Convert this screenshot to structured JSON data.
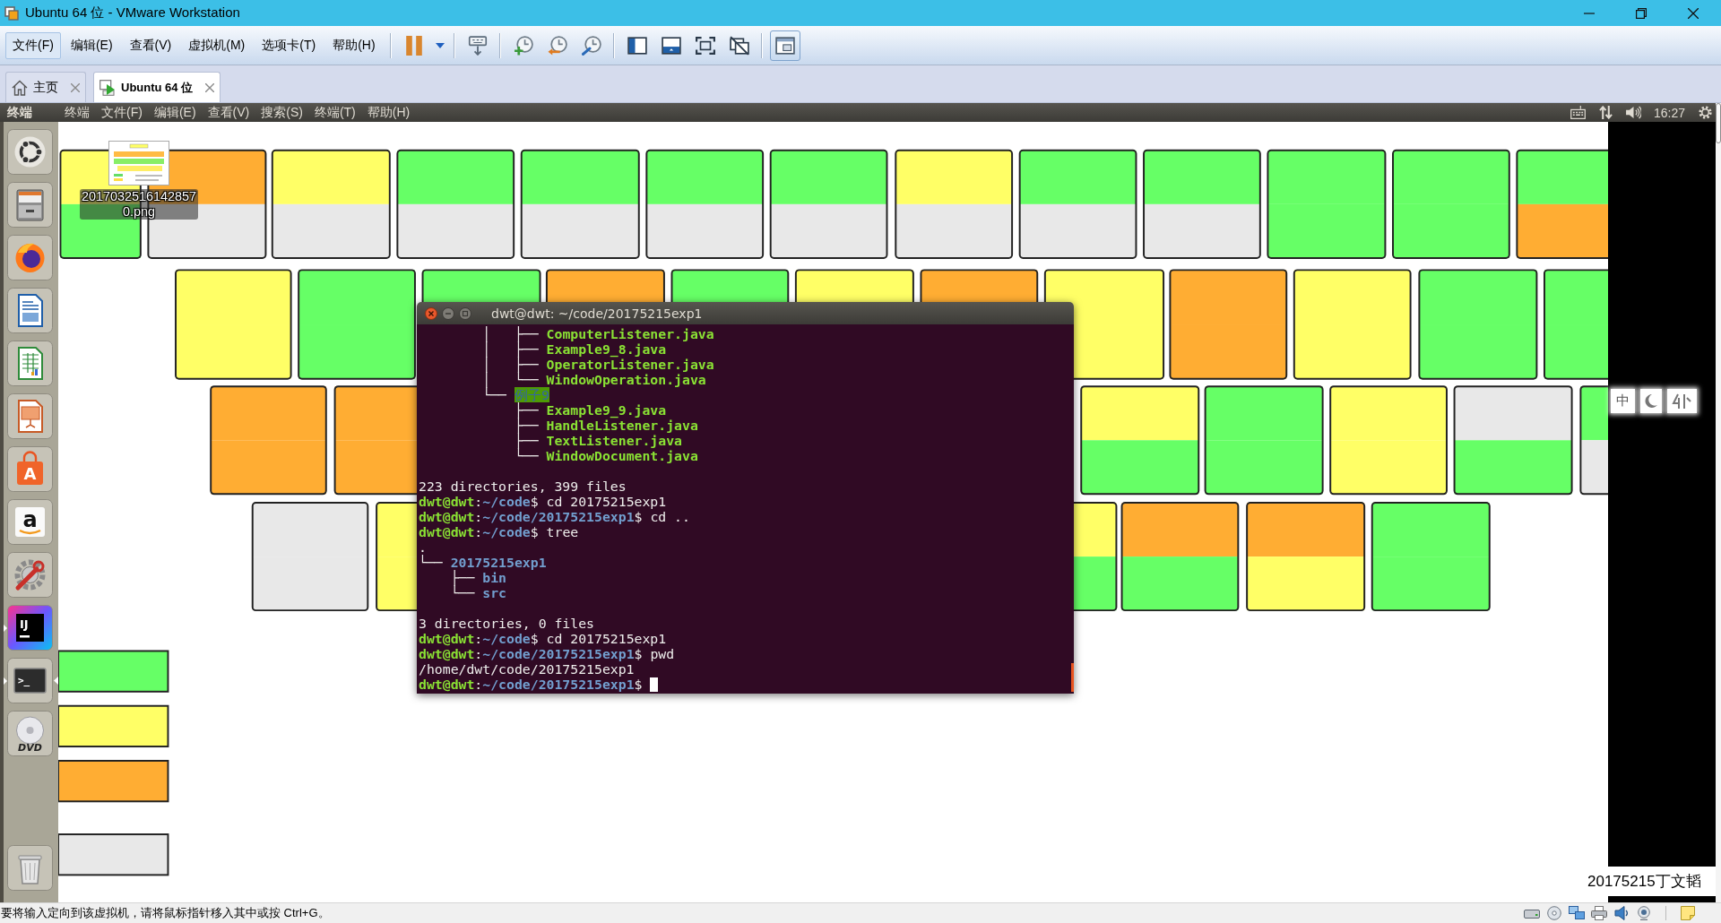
{
  "window": {
    "title": "Ubuntu 64 位 - VMware Workstation"
  },
  "menu": [
    {
      "label": "文件(F)",
      "highlighted": true
    },
    {
      "label": "编辑(E)",
      "highlighted": false
    },
    {
      "label": "查看(V)",
      "highlighted": false
    },
    {
      "label": "虚拟机(M)",
      "highlighted": false
    },
    {
      "label": "选项卡(T)",
      "highlighted": false
    },
    {
      "label": "帮助(H)",
      "highlighted": false
    }
  ],
  "toolbar": [
    [
      {
        "kind": "pause",
        "pressed": false
      },
      {
        "kind": "dropdown",
        "pressed": false
      }
    ],
    [
      {
        "kind": "send_keys",
        "pressed": false
      }
    ],
    [
      {
        "kind": "snapshot_take",
        "pressed": false
      },
      {
        "kind": "snapshot_revert",
        "pressed": false
      },
      {
        "kind": "snapshot_manager",
        "pressed": false
      }
    ],
    [
      {
        "kind": "sidebar",
        "pressed": false
      },
      {
        "kind": "thumbnail_bar",
        "pressed": false
      },
      {
        "kind": "fullscreen",
        "pressed": false
      },
      {
        "kind": "unity",
        "pressed": false
      }
    ],
    [
      {
        "kind": "console_view",
        "pressed": true
      }
    ]
  ],
  "tabs": [
    {
      "kind": "home",
      "label": "主页",
      "selected": false
    },
    {
      "kind": "vm",
      "label": "Ubuntu 64 位",
      "selected": true
    }
  ],
  "guest": {
    "top_bar": {
      "app_name": "终端",
      "menus": [
        "终端",
        "文件(F)",
        "编辑(E)",
        "查看(V)",
        "搜索(S)",
        "终端(T)",
        "帮助(H)"
      ],
      "clock": "16:27"
    },
    "launcher": [
      {
        "kind": "dash",
        "running": false,
        "focused": false
      },
      {
        "kind": "files",
        "running": false,
        "focused": false
      },
      {
        "kind": "browser",
        "running": false,
        "focused": false
      },
      {
        "kind": "writer",
        "running": false,
        "focused": false
      },
      {
        "kind": "calc",
        "running": false,
        "focused": false
      },
      {
        "kind": "impress",
        "running": false,
        "focused": false
      },
      {
        "kind": "store",
        "glyph": "A",
        "running": false,
        "focused": false
      },
      {
        "kind": "shop",
        "glyph": "a",
        "running": false,
        "focused": false
      },
      {
        "kind": "settings",
        "running": false,
        "focused": false
      },
      {
        "kind": "ide",
        "glyph": "IJ",
        "running": true,
        "focused": false
      },
      {
        "kind": "terminal",
        "glyph": ">_",
        "running": true,
        "focused": true
      },
      {
        "kind": "dvd",
        "glyph": "DVD",
        "running": false,
        "focused": false
      },
      {
        "kind": "trash",
        "running": false,
        "focused": false
      }
    ],
    "desktop_icons": [
      {
        "label": "20170325161428570.png"
      }
    ],
    "terminal": {
      "title": "dwt@dwt: ~/code/20175215exp1",
      "lines": [
        {
          "kind": "file_entry",
          "prefix": "        │   ├── ",
          "name": "ComputerListener.java"
        },
        {
          "kind": "file_entry",
          "prefix": "        │   ├── ",
          "name": "Example9_8.java"
        },
        {
          "kind": "file_entry",
          "prefix": "        │   ├── ",
          "name": "OperatorListener.java"
        },
        {
          "kind": "file_entry",
          "prefix": "        │   └── ",
          "name": "WindowOperation.java"
        },
        {
          "kind": "shared_dir_entry",
          "prefix": "        └── ",
          "name": "例子9"
        },
        {
          "kind": "file_entry",
          "prefix": "            ├── ",
          "name": "Example9_9.java"
        },
        {
          "kind": "file_entry",
          "prefix": "            ├── ",
          "name": "HandleListener.java"
        },
        {
          "kind": "file_entry",
          "prefix": "            ├── ",
          "name": "TextListener.java"
        },
        {
          "kind": "file_entry",
          "prefix": "            └── ",
          "name": "WindowDocument.java"
        },
        {
          "kind": "blank"
        },
        {
          "kind": "output",
          "text": "223 directories, 399 files"
        },
        {
          "kind": "prompt",
          "user": "dwt@dwt",
          "separator": ":",
          "path": "~/code",
          "symbol": "$",
          "command": "cd 20175215exp1",
          "cursor": false
        },
        {
          "kind": "prompt",
          "user": "dwt@dwt",
          "separator": ":",
          "path": "~/code/20175215exp1",
          "symbol": "$",
          "command": "cd ..",
          "cursor": false
        },
        {
          "kind": "prompt",
          "user": "dwt@dwt",
          "separator": ":",
          "path": "~/code",
          "symbol": "$",
          "command": "tree",
          "cursor": false
        },
        {
          "kind": "output",
          "text": "."
        },
        {
          "kind": "dir_entry",
          "prefix": "└── ",
          "name": "20175215exp1"
        },
        {
          "kind": "dir_entry",
          "prefix": "    ├── ",
          "name": "bin"
        },
        {
          "kind": "dir_entry",
          "prefix": "    └── ",
          "name": "src"
        },
        {
          "kind": "blank"
        },
        {
          "kind": "output",
          "text": "3 directories, 0 files"
        },
        {
          "kind": "prompt",
          "user": "dwt@dwt",
          "separator": ":",
          "path": "~/code",
          "symbol": "$",
          "command": "cd 20175215exp1",
          "cursor": false
        },
        {
          "kind": "prompt",
          "user": "dwt@dwt",
          "separator": ":",
          "path": "~/code/20175215exp1",
          "symbol": "$",
          "command": "pwd",
          "cursor": false
        },
        {
          "kind": "output",
          "text": "/home/dwt/code/20175215exp1"
        },
        {
          "kind": "prompt",
          "user": "dwt@dwt",
          "separator": ":",
          "path": "~/code/20175215exp1",
          "symbol": "$",
          "cursor": true
        }
      ]
    },
    "ime_bar": {
      "mode": "中"
    },
    "name_label": "20175215丁文韬"
  },
  "status_bar": {
    "message": "要将输入定向到该虚拟机，请将鼠标指针移入其中或按 Ctrl+G。"
  }
}
